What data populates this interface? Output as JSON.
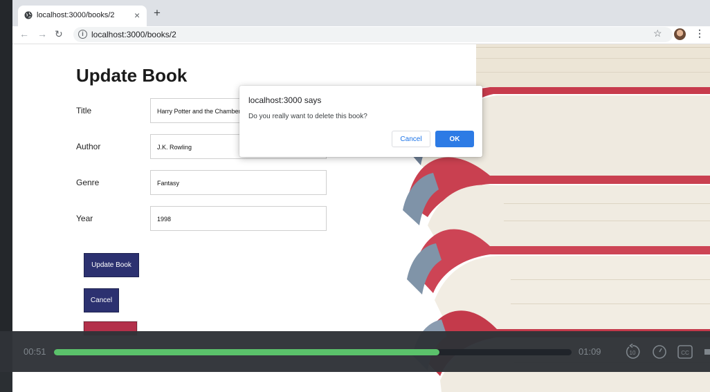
{
  "browser": {
    "tab_title": "localhost:3000/books/2",
    "tab_close_glyph": "×",
    "new_tab_glyph": "+",
    "back_glyph": "←",
    "forward_glyph": "→",
    "reload_glyph": "↻",
    "url": "localhost:3000/books/2",
    "star_glyph": "☆",
    "menu_glyph": "⋮",
    "info_glyph": "i"
  },
  "page": {
    "title": "Update Book",
    "fields": [
      {
        "label": "Title",
        "value": "Harry Potter and the Chamber of Secrets"
      },
      {
        "label": "Author",
        "value": "J.K. Rowling"
      },
      {
        "label": "Genre",
        "value": "Fantasy"
      },
      {
        "label": "Year",
        "value": "1998"
      }
    ],
    "update_button": "Update Book",
    "cancel_button": "Cancel"
  },
  "dialog": {
    "title": "localhost:3000 says",
    "message": "Do you really want to delete this book?",
    "cancel": "Cancel",
    "ok": "OK"
  },
  "player": {
    "current_time": "00:51",
    "duration": "01:09",
    "progress_fraction": 0.745,
    "icons": [
      "replay-10-icon",
      "playback-speed-icon",
      "closed-captions-icon",
      "volume-icon"
    ],
    "accent_color": "#5bc26b"
  },
  "colors": {
    "primary_button": "#2c3170",
    "delete_button": "#b3304a",
    "dialog_ok": "#2d7be5"
  }
}
